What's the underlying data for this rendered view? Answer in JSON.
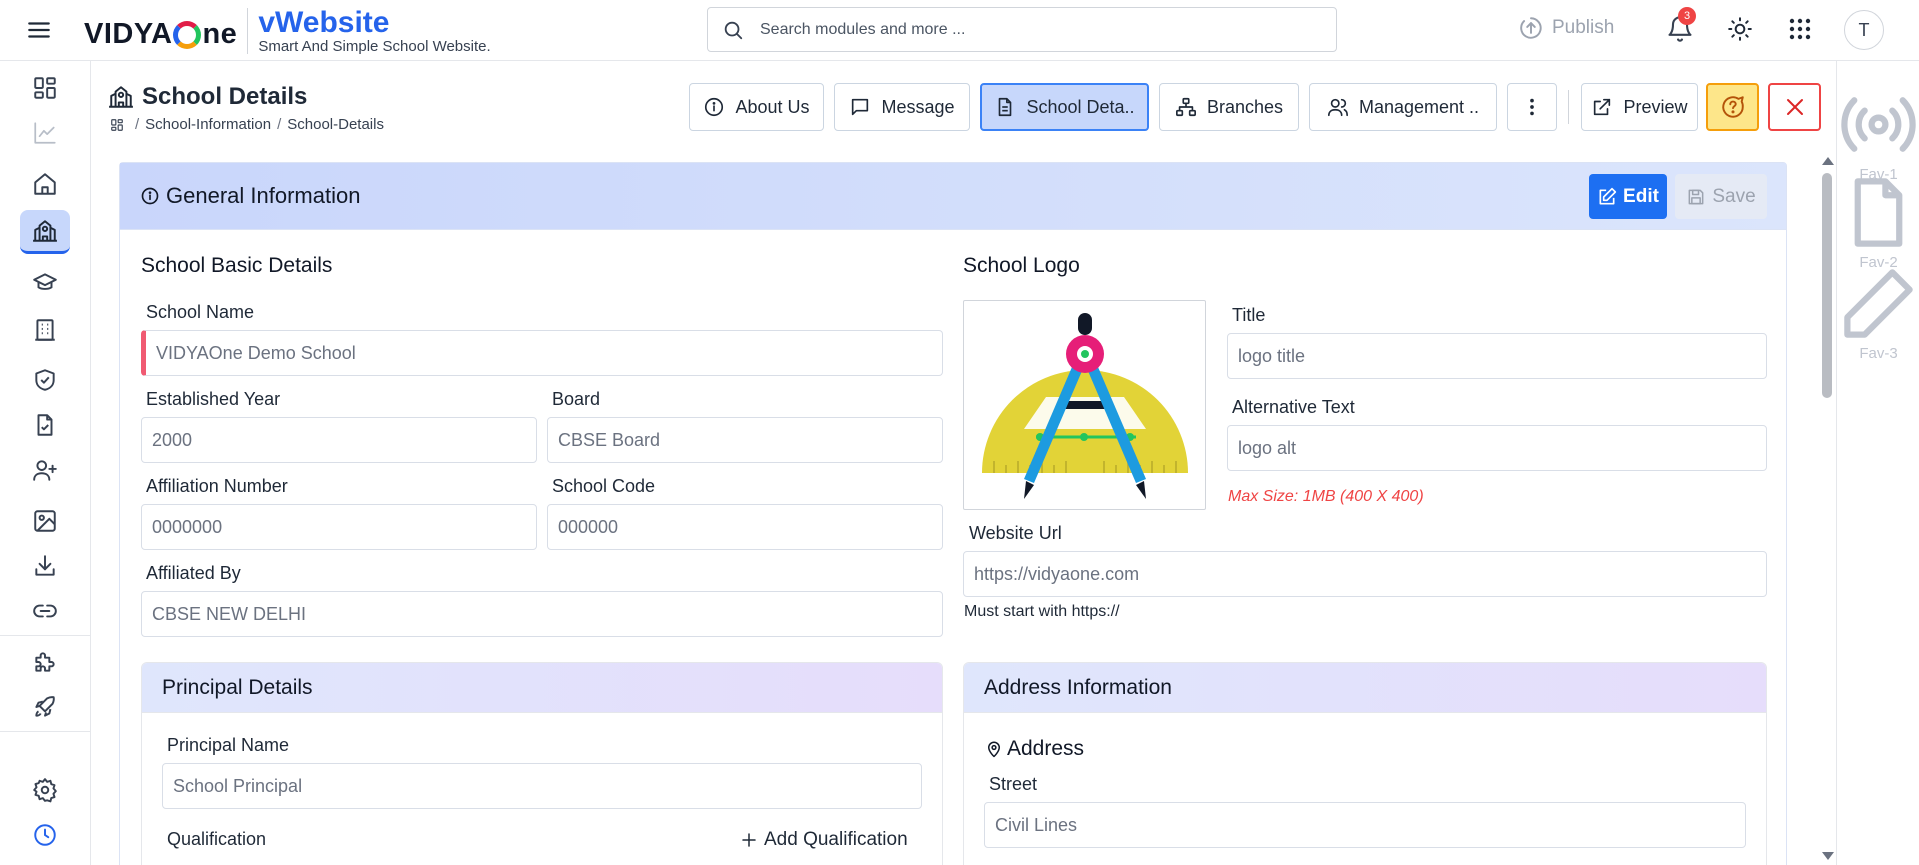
{
  "header": {
    "brand_logo_left": "VIDYA",
    "brand_logo_right": "ne",
    "brand_title": "vWebsite",
    "brand_subtitle": "Smart And Simple School Website.",
    "search_placeholder": "Search modules and more ...",
    "publish_label": "Publish",
    "notification_count": "3",
    "avatar_initial": "T"
  },
  "favorites": [
    "Fav-1",
    "Fav-2",
    "Fav-3"
  ],
  "page": {
    "title": "School Details",
    "breadcrumb": [
      "School-Information",
      "School-Details"
    ]
  },
  "tabs": {
    "about": "About Us",
    "message": "Message",
    "school_details": "School Deta..",
    "branches": "Branches",
    "management": "Management ..",
    "preview": "Preview"
  },
  "general": {
    "title": "General Information",
    "edit_label": "Edit",
    "save_label": "Save"
  },
  "basic": {
    "title": "School Basic Details",
    "school_name_label": "School Name",
    "school_name": "VIDYAOne Demo School",
    "established_label": "Established Year",
    "established": "2000",
    "board_label": "Board",
    "board": "CBSE Board",
    "affiliation_number_label": "Affiliation Number",
    "affiliation_number": "0000000",
    "school_code_label": "School Code",
    "school_code": "000000",
    "affiliated_by_label": "Affiliated By",
    "affiliated_by": "CBSE NEW DELHI"
  },
  "logo": {
    "title": "School Logo",
    "title_label": "Title",
    "title_value": "logo title",
    "alt_label": "Alternative Text",
    "alt_value": "logo alt",
    "max_size_hint": "Max Size: 1MB (400 X 400)",
    "website_label": "Website Url",
    "website_value": "https://vidyaone.com",
    "website_hint": "Must start with https://"
  },
  "principal": {
    "title": "Principal Details",
    "name_label": "Principal Name",
    "name_value": "School Principal",
    "qualification_label": "Qualification",
    "add_qualification": "Add Qualification"
  },
  "address": {
    "title": "Address Information",
    "address_label": "Address",
    "street_label": "Street",
    "street_value": "Civil Lines"
  },
  "colors": {
    "accent": "#2563eb",
    "active_tab_bg": "#c7d7fb",
    "required_marker": "#f05a72",
    "notification_badge": "#ef4444"
  }
}
